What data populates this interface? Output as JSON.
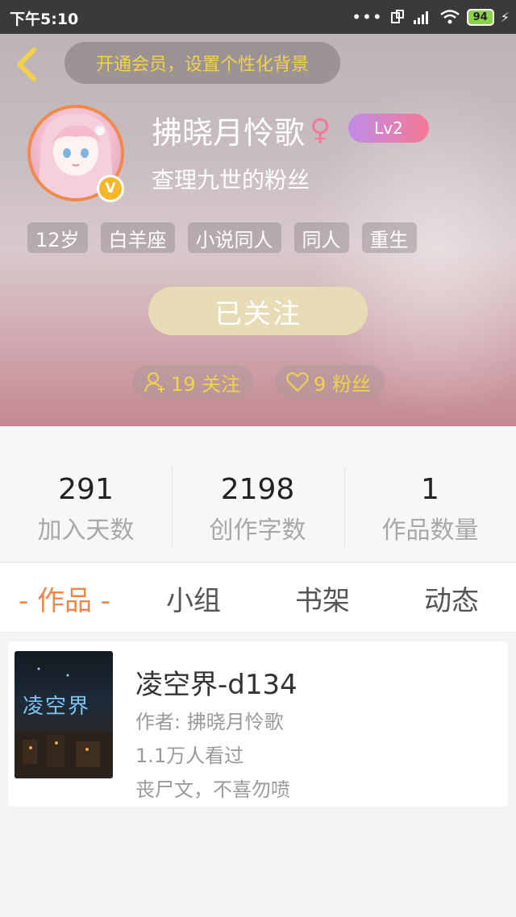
{
  "status_bar": {
    "time": "下午5:10",
    "battery": "94"
  },
  "header": {
    "vip_prompt": "开通会员，设置个性化背景",
    "username": "拂晓月怜歌",
    "level": "Lv2",
    "subtitle": "查理九世的粉丝",
    "tags": [
      "12岁",
      "白羊座",
      "小说同人",
      "同人",
      "重生"
    ],
    "follow_button": "已关注",
    "following": "19 关注",
    "fans": "9 粉丝",
    "verify_badge": "V"
  },
  "stats": [
    {
      "value": "291",
      "label": "加入天数"
    },
    {
      "value": "2198",
      "label": "创作字数"
    },
    {
      "value": "1",
      "label": "作品数量"
    }
  ],
  "tabs": [
    "- 作品 -",
    "小组",
    "书架",
    "动态"
  ],
  "works": [
    {
      "title": "凌空界-d134",
      "author": "作者: 拂晓月怜歌",
      "views": "1.1万人看过",
      "desc": "丧尸文，不喜勿喷",
      "cover_text": "凌空界"
    }
  ],
  "colors": {
    "accent": "#f0874a",
    "gold": "#f2d24a",
    "female": "#f07a9c"
  },
  "icons": [
    "back-arrow-icon",
    "female-icon",
    "user-plus-icon",
    "heart-icon",
    "verify-icon"
  ]
}
